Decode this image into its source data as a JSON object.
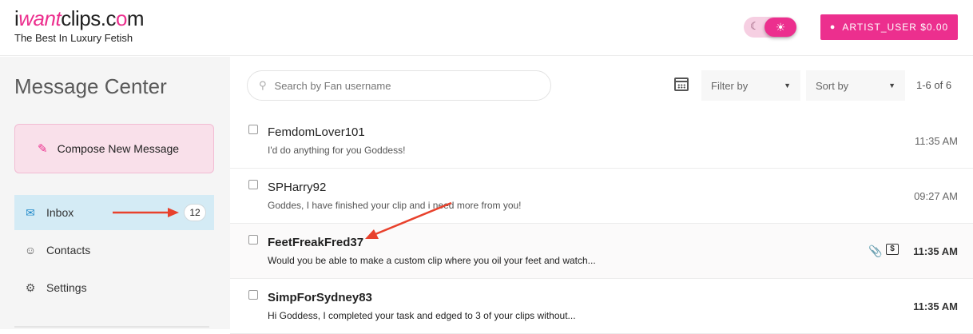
{
  "header": {
    "logo_prefix": "i",
    "logo_want": "want",
    "logo_clips": "clips.c",
    "logo_o": "o",
    "logo_m": "m",
    "tagline": "The Best In Luxury Fetish",
    "theme_toggle": {
      "dark_icon": "moon-icon",
      "light_icon": "sun-icon",
      "active": "light"
    },
    "user_button_label": "ARTIST_USER $0.00"
  },
  "sidebar": {
    "title": "Message Center",
    "compose_label": "Compose New Message",
    "items": [
      {
        "label": "Inbox",
        "icon": "mail-icon",
        "badge": "12",
        "active": true
      },
      {
        "label": "Contacts",
        "icon": "contacts-icon"
      },
      {
        "label": "Settings",
        "icon": "gear-icon"
      }
    ]
  },
  "toolbar": {
    "search_placeholder": "Search by Fan username",
    "filter_label": "Filter by",
    "sort_label": "Sort by",
    "count": "1-6 of 6"
  },
  "messages": [
    {
      "name": "FemdomLover101",
      "preview": "I'd do anything for you Goddess!",
      "time": "11:35 AM",
      "unread": false
    },
    {
      "name": "SPHarry92",
      "preview": "Goddes, I have finished your clip and i need more from you!",
      "time": "09:27 AM",
      "unread": false
    },
    {
      "name": "FeetFreakFred37",
      "preview": "Would you be able to make a custom clip where you oil your feet and watch...",
      "time": "11:35 AM",
      "unread": true,
      "has_attachment": true,
      "has_tip": true
    },
    {
      "name": "SimpForSydney83",
      "preview": "Hi Goddess, I completed your task and edged to 3 of your clips without...",
      "time": "11:35 AM",
      "unread": true
    }
  ],
  "colors": {
    "brand": "#ec2f8e",
    "active_nav": "#d4ebf5",
    "annotation_arrow": "#e8412c"
  }
}
